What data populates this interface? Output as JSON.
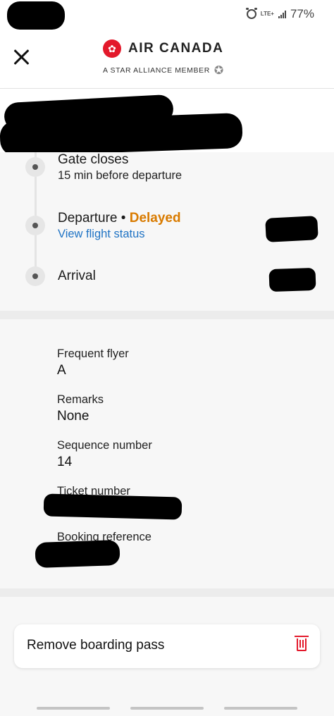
{
  "status_bar": {
    "network": "LTE+",
    "battery": "77%"
  },
  "header": {
    "brand": "AIR CANADA",
    "tagline": "A STAR ALLIANCE MEMBER",
    "colors": {
      "brand_red": "#e3192b"
    }
  },
  "timeline": {
    "gate": {
      "title": "Gate closes",
      "subtitle": "15 min before departure"
    },
    "departure": {
      "title": "Departure",
      "separator": "•",
      "status": "Delayed",
      "link": "View flight status"
    },
    "arrival": {
      "title": "Arrival"
    },
    "colors": {
      "delayed": "#d97b00",
      "link": "#1f73c4"
    }
  },
  "details": {
    "frequent_flyer": {
      "label": "Frequent flyer",
      "value": "A"
    },
    "remarks": {
      "label": "Remarks",
      "value": "None"
    },
    "sequence": {
      "label": "Sequence number",
      "value": "14"
    },
    "ticket": {
      "label": "Ticket number"
    },
    "booking": {
      "label": "Booking reference"
    }
  },
  "actions": {
    "remove_label": "Remove boarding pass",
    "remove_icon": "trash-icon"
  }
}
